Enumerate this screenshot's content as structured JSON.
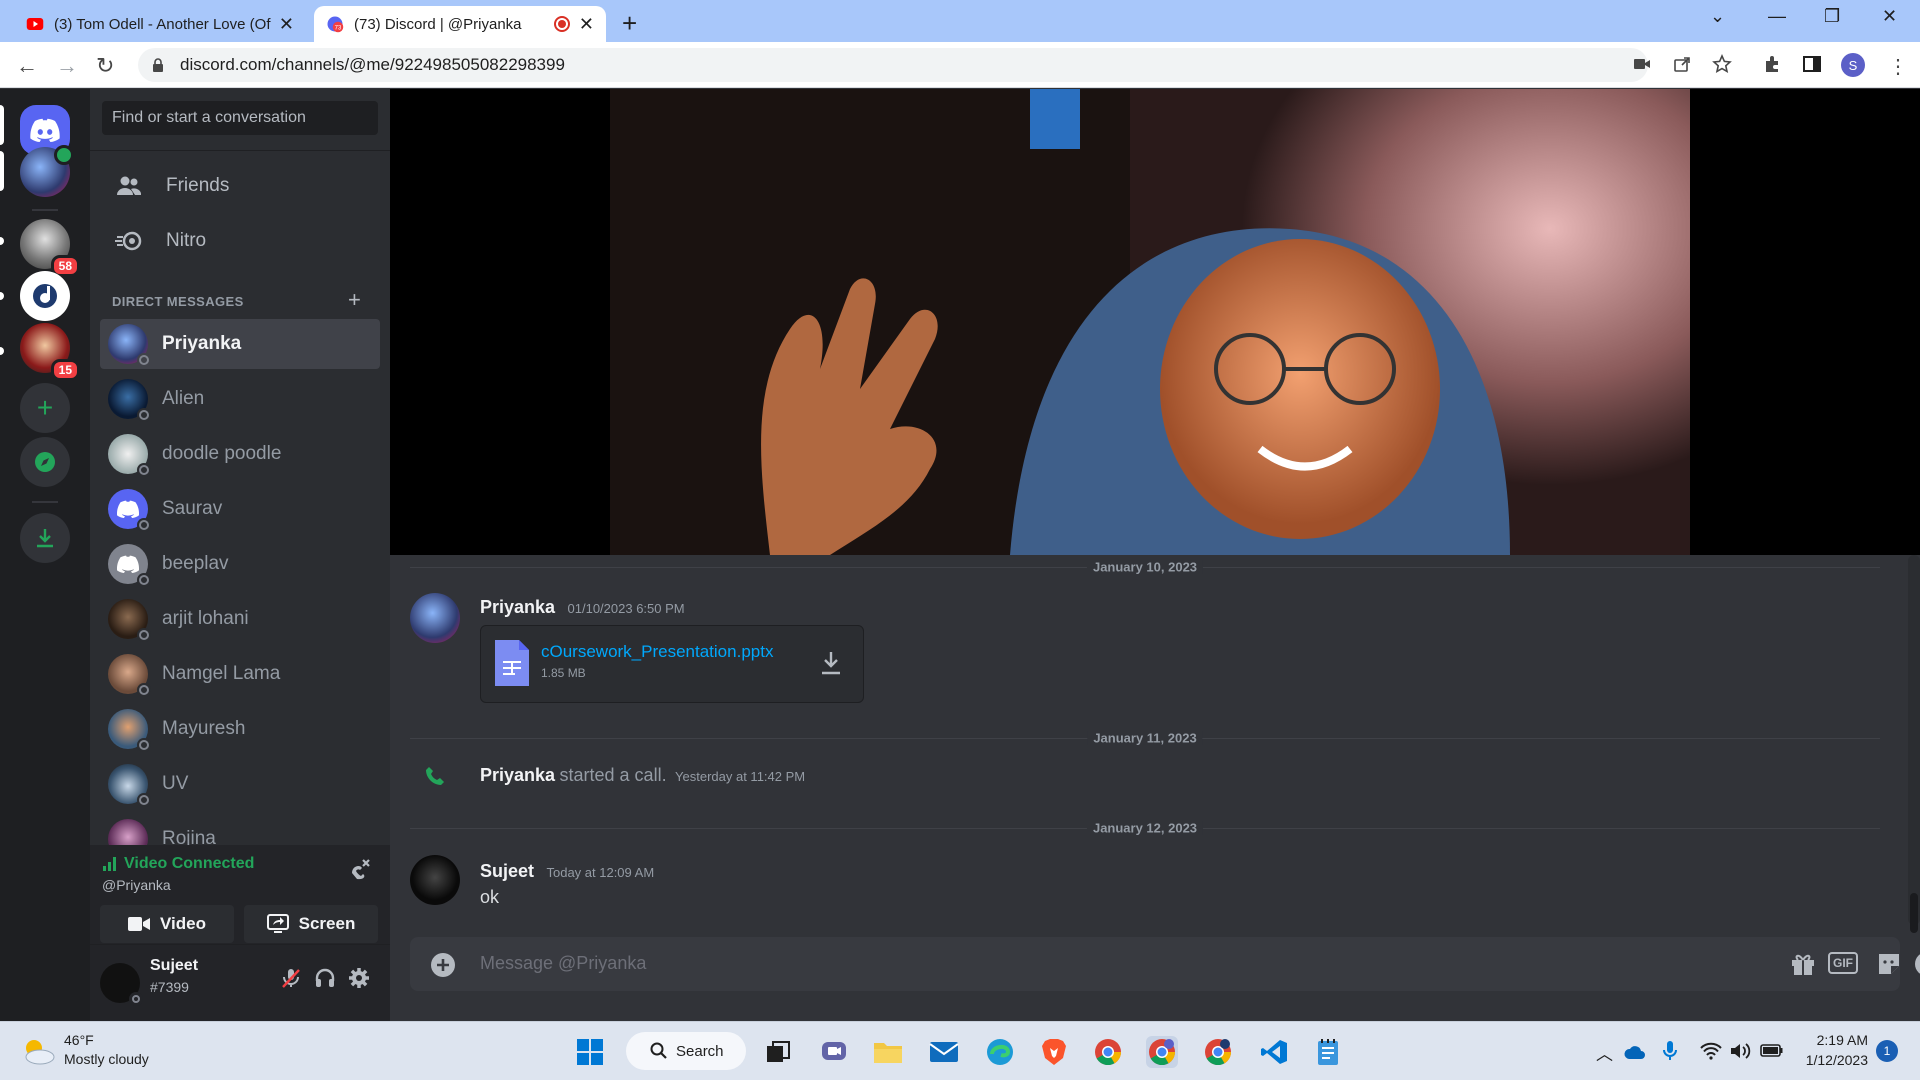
{
  "browser": {
    "tabs": [
      {
        "title": "(3) Tom Odell - Another Love (Of",
        "active": false
      },
      {
        "title": "(73) Discord | @Priyanka",
        "active": true
      }
    ],
    "url": "discord.com/channels/@me/922498505082298399",
    "profile_initial": "S"
  },
  "rail": {
    "badges": [
      "58",
      "15"
    ]
  },
  "sidebar": {
    "search_placeholder": "Find or start a conversation",
    "nav": [
      {
        "label": "Friends",
        "icon": "friends-icon"
      },
      {
        "label": "Nitro",
        "icon": "nitro-icon"
      }
    ],
    "dm_header": "DIRECT MESSAGES",
    "dms": [
      {
        "name": "Priyanka",
        "active": true
      },
      {
        "name": "Alien"
      },
      {
        "name": "doodle poodle"
      },
      {
        "name": "Saurav"
      },
      {
        "name": "beeplav"
      },
      {
        "name": "arjit lohani"
      },
      {
        "name": "Namgel Lama"
      },
      {
        "name": "Mayuresh"
      },
      {
        "name": "UV"
      },
      {
        "name": "Rojina"
      }
    ],
    "voice": {
      "status": "Video Connected",
      "channel": "@Priyanka",
      "video_label": "Video",
      "screen_label": "Screen"
    },
    "user": {
      "name": "Sujeet",
      "tag": "#7399"
    }
  },
  "chat": {
    "messages": [
      {
        "date": "January 10, 2023",
        "author": "Priyanka",
        "timestamp": "01/10/2023 6:50 PM",
        "attachment": {
          "name": "cOursework_Presentation.pptx",
          "size": "1.85 MB"
        }
      },
      {
        "date": "January 11, 2023",
        "author": "Priyanka",
        "action": "started a call.",
        "timestamp": "Yesterday at 11:42 PM"
      },
      {
        "date": "January 12, 2023",
        "author": "Sujeet",
        "timestamp": "Today at 12:09 AM",
        "text": "ok"
      }
    ],
    "composer_placeholder": "Message @Priyanka",
    "gif_label": "GIF"
  },
  "taskbar": {
    "weather_temp": "46°F",
    "weather_desc": "Mostly cloudy",
    "search_label": "Search",
    "time": "2:19 AM",
    "date": "1/12/2023",
    "notifications": "1"
  },
  "colors": {
    "blurple": "#5865f2",
    "green": "#23a55a",
    "red": "#f23f43",
    "link": "#00a8fc"
  }
}
